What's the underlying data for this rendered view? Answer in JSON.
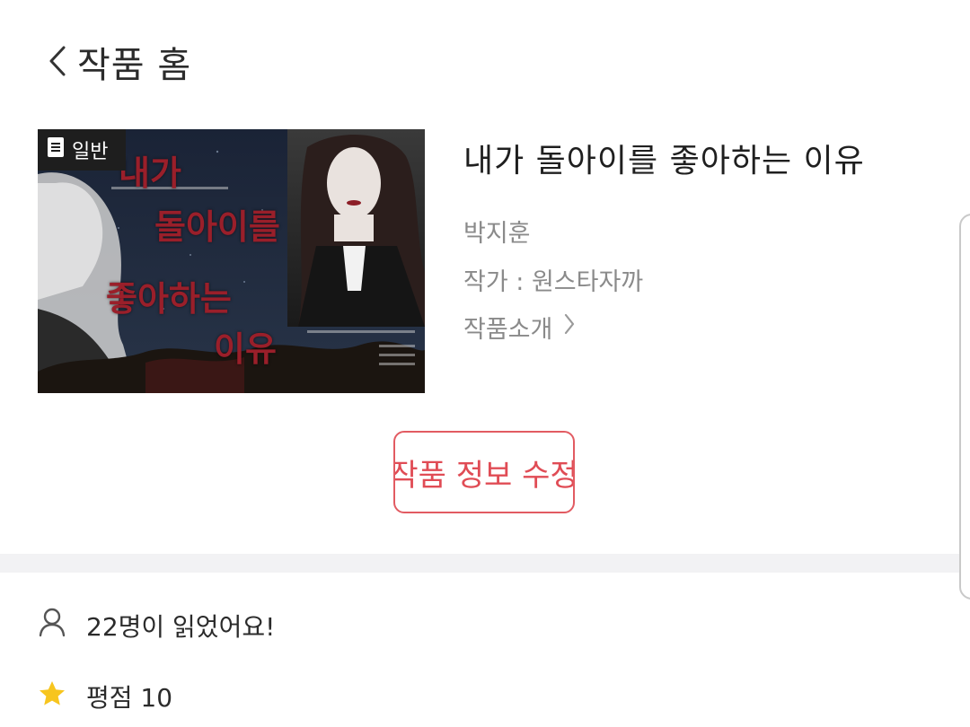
{
  "header": {
    "title": "작품 홈"
  },
  "cover": {
    "genre_badge": "일반",
    "cover_lines": [
      "내가",
      "돌아이를",
      "좋아하는",
      "이유"
    ]
  },
  "work": {
    "title": "내가 돌아이를 좋아하는 이유",
    "character": "박지훈",
    "author_line": "작가 : 원스타자까",
    "intro_label": "작품소개"
  },
  "actions": {
    "edit_label": "작품 정보 수정"
  },
  "stats": {
    "read_text": "22명이 읽었어요!",
    "rating_text": "평점 10"
  },
  "colors": {
    "accent_red": "#e04c55",
    "star": "#f7c51e"
  }
}
